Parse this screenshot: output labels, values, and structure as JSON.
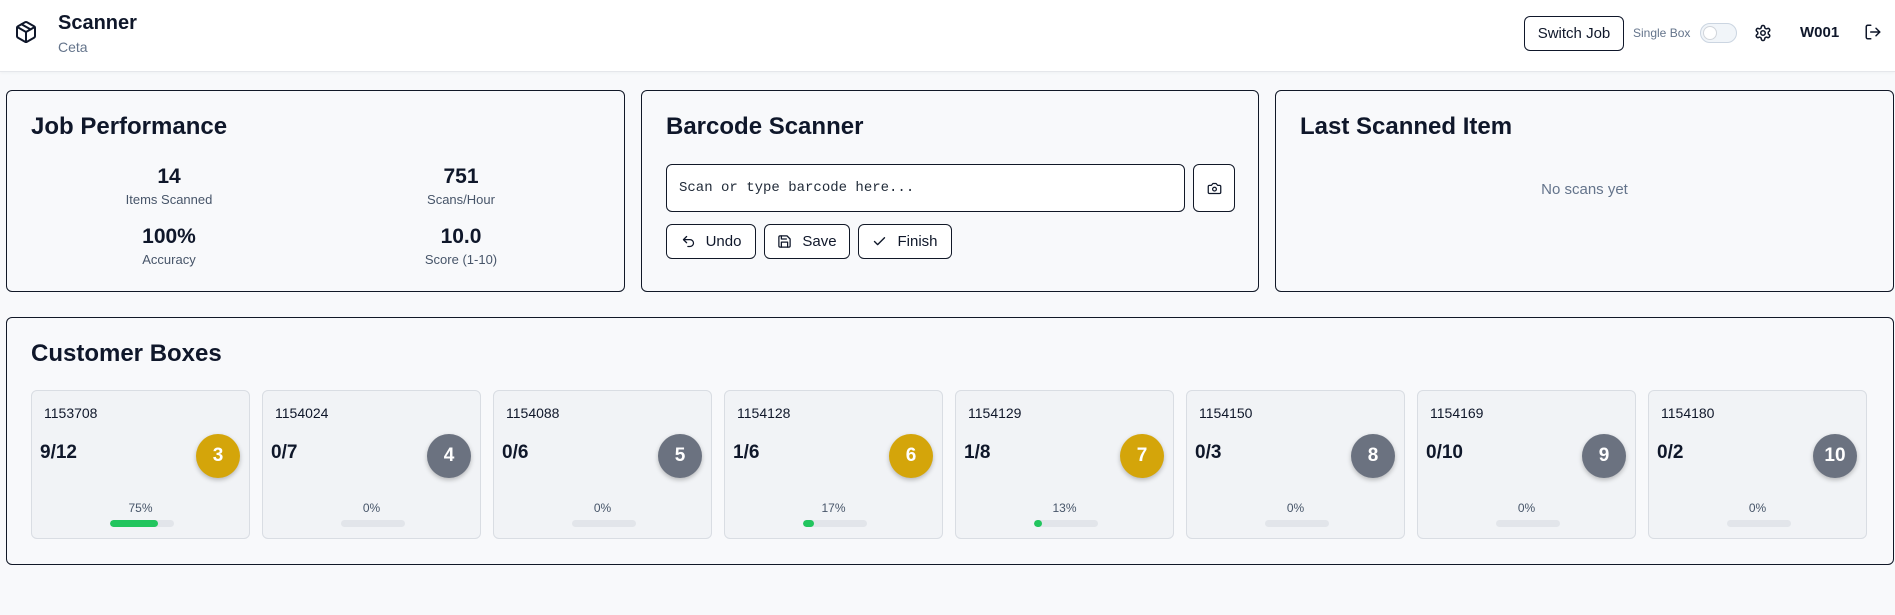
{
  "header": {
    "title": "Scanner",
    "subtitle": "Ceta",
    "switch_job_label": "Switch Job",
    "single_box_label": "Single Box",
    "single_box_on": false,
    "user_code": "W001",
    "icons": [
      "package-icon",
      "gear-icon",
      "logout-icon"
    ]
  },
  "job_performance": {
    "title": "Job Performance",
    "stats": [
      {
        "value": "14",
        "label": "Items Scanned"
      },
      {
        "value": "751",
        "label": "Scans/Hour"
      },
      {
        "value": "100%",
        "label": "Accuracy"
      },
      {
        "value": "10.0",
        "label": "Score (1-10)"
      }
    ]
  },
  "barcode_scanner": {
    "title": "Barcode Scanner",
    "placeholder": "Scan or type barcode here...",
    "value": "",
    "undo_label": "Undo",
    "save_label": "Save",
    "finish_label": "Finish"
  },
  "last_scanned": {
    "title": "Last Scanned Item",
    "empty_text": "No scans yet"
  },
  "customer_boxes": {
    "title": "Customer Boxes",
    "colors": {
      "active": "#d4a50a",
      "idle": "#6b7280",
      "progress": "#22c55e"
    },
    "boxes": [
      {
        "id": "1153708",
        "count": "9/12",
        "number": "3",
        "status": "active",
        "pct_label": "75%",
        "progress": 0.75
      },
      {
        "id": "1154024",
        "count": "0/7",
        "number": "4",
        "status": "idle",
        "pct_label": "0%",
        "progress": 0
      },
      {
        "id": "1154088",
        "count": "0/6",
        "number": "5",
        "status": "idle",
        "pct_label": "0%",
        "progress": 0
      },
      {
        "id": "1154128",
        "count": "1/6",
        "number": "6",
        "status": "active",
        "pct_label": "17%",
        "progress": 0.17
      },
      {
        "id": "1154129",
        "count": "1/8",
        "number": "7",
        "status": "active",
        "pct_label": "13%",
        "progress": 0.13
      },
      {
        "id": "1154150",
        "count": "0/3",
        "number": "8",
        "status": "idle",
        "pct_label": "0%",
        "progress": 0
      },
      {
        "id": "1154169",
        "count": "0/10",
        "number": "9",
        "status": "idle",
        "pct_label": "0%",
        "progress": 0
      },
      {
        "id": "1154180",
        "count": "0/2",
        "number": "10",
        "status": "idle",
        "pct_label": "0%",
        "progress": 0
      }
    ]
  }
}
